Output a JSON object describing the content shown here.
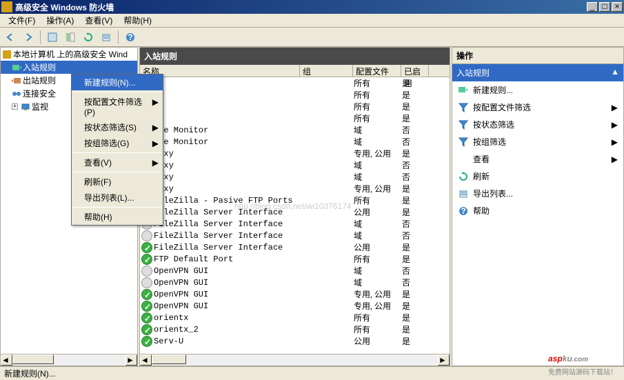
{
  "window": {
    "title": "高级安全 Windows 防火墙",
    "min": "_",
    "max": "□",
    "close": "×"
  },
  "menubar": {
    "file": "文件(F)",
    "action": "操作(A)",
    "view": "查看(V)",
    "help": "帮助(H)"
  },
  "tree": {
    "root": "本地计算机 上的高级安全 Wind",
    "inbound": "入站规则",
    "outbound": "出站规则",
    "connsec": "连接安全",
    "monitor": "监视"
  },
  "center": {
    "title": "入站规则",
    "cols": {
      "name": "名称",
      "group": "组",
      "profile": "配置文件",
      "enabled": "已启用"
    }
  },
  "rules": [
    {
      "name": "",
      "profile": "所有",
      "enabled": "是",
      "on": true
    },
    {
      "name": "",
      "profile": "所有",
      "enabled": "是",
      "on": true
    },
    {
      "name": "",
      "profile": "所有",
      "enabled": "是",
      "on": true
    },
    {
      "name": "",
      "profile": "所有",
      "enabled": "是",
      "on": true
    },
    {
      "name": "che Monitor",
      "profile": "域",
      "enabled": "否",
      "on": false
    },
    {
      "name": "che Monitor",
      "profile": "域",
      "enabled": "否",
      "on": false
    },
    {
      "name": "roxy",
      "profile": "专用, 公用",
      "enabled": "是",
      "on": true
    },
    {
      "name": "roxy",
      "profile": "域",
      "enabled": "否",
      "on": false
    },
    {
      "name": "roxy",
      "profile": "域",
      "enabled": "否",
      "on": false
    },
    {
      "name": "roxy",
      "profile": "专用, 公用",
      "enabled": "是",
      "on": true
    },
    {
      "name": "FileZilla - Pasive FTP Ports",
      "profile": "所有",
      "enabled": "是",
      "on": true
    },
    {
      "name": "FileZilla Server Interface",
      "profile": "公用",
      "enabled": "是",
      "on": true
    },
    {
      "name": "FileZilla Server Interface",
      "profile": "域",
      "enabled": "否",
      "on": false
    },
    {
      "name": "FileZilla Server Interface",
      "profile": "域",
      "enabled": "否",
      "on": false
    },
    {
      "name": "FileZilla Server Interface",
      "profile": "公用",
      "enabled": "是",
      "on": true
    },
    {
      "name": "FTP Default Port",
      "profile": "所有",
      "enabled": "是",
      "on": true
    },
    {
      "name": "OpenVPN GUI",
      "profile": "域",
      "enabled": "否",
      "on": false
    },
    {
      "name": "OpenVPN GUI",
      "profile": "域",
      "enabled": "否",
      "on": false
    },
    {
      "name": "OpenVPN GUI",
      "profile": "专用, 公用",
      "enabled": "是",
      "on": true
    },
    {
      "name": "OpenVPN GUI",
      "profile": "专用, 公用",
      "enabled": "是",
      "on": true
    },
    {
      "name": "orientx",
      "profile": "所有",
      "enabled": "是",
      "on": true
    },
    {
      "name": "orientx_2",
      "profile": "所有",
      "enabled": "是",
      "on": true
    },
    {
      "name": "Serv-U",
      "profile": "公用",
      "enabled": "是",
      "on": true
    }
  ],
  "context_menu": {
    "new_rule": "新建规则(N)...",
    "filter_profile": "按配置文件筛选(P)",
    "filter_state": "按状态筛选(S)",
    "filter_group": "按组筛选(G)",
    "view": "查看(V)",
    "refresh": "刷新(F)",
    "export": "导出列表(L)...",
    "help": "帮助(H)"
  },
  "actions": {
    "header": "操作",
    "subheader": "入站规则",
    "new_rule": "新建规则...",
    "filter_profile": "按配置文件筛选",
    "filter_state": "按状态筛选",
    "filter_group": "按组筛选",
    "view": "查看",
    "refresh": "刷新",
    "export": "导出列表...",
    "help": "帮助"
  },
  "status": "新建规则(N)...",
  "watermark": "http://blog.csdn.net/wi10376174"
}
